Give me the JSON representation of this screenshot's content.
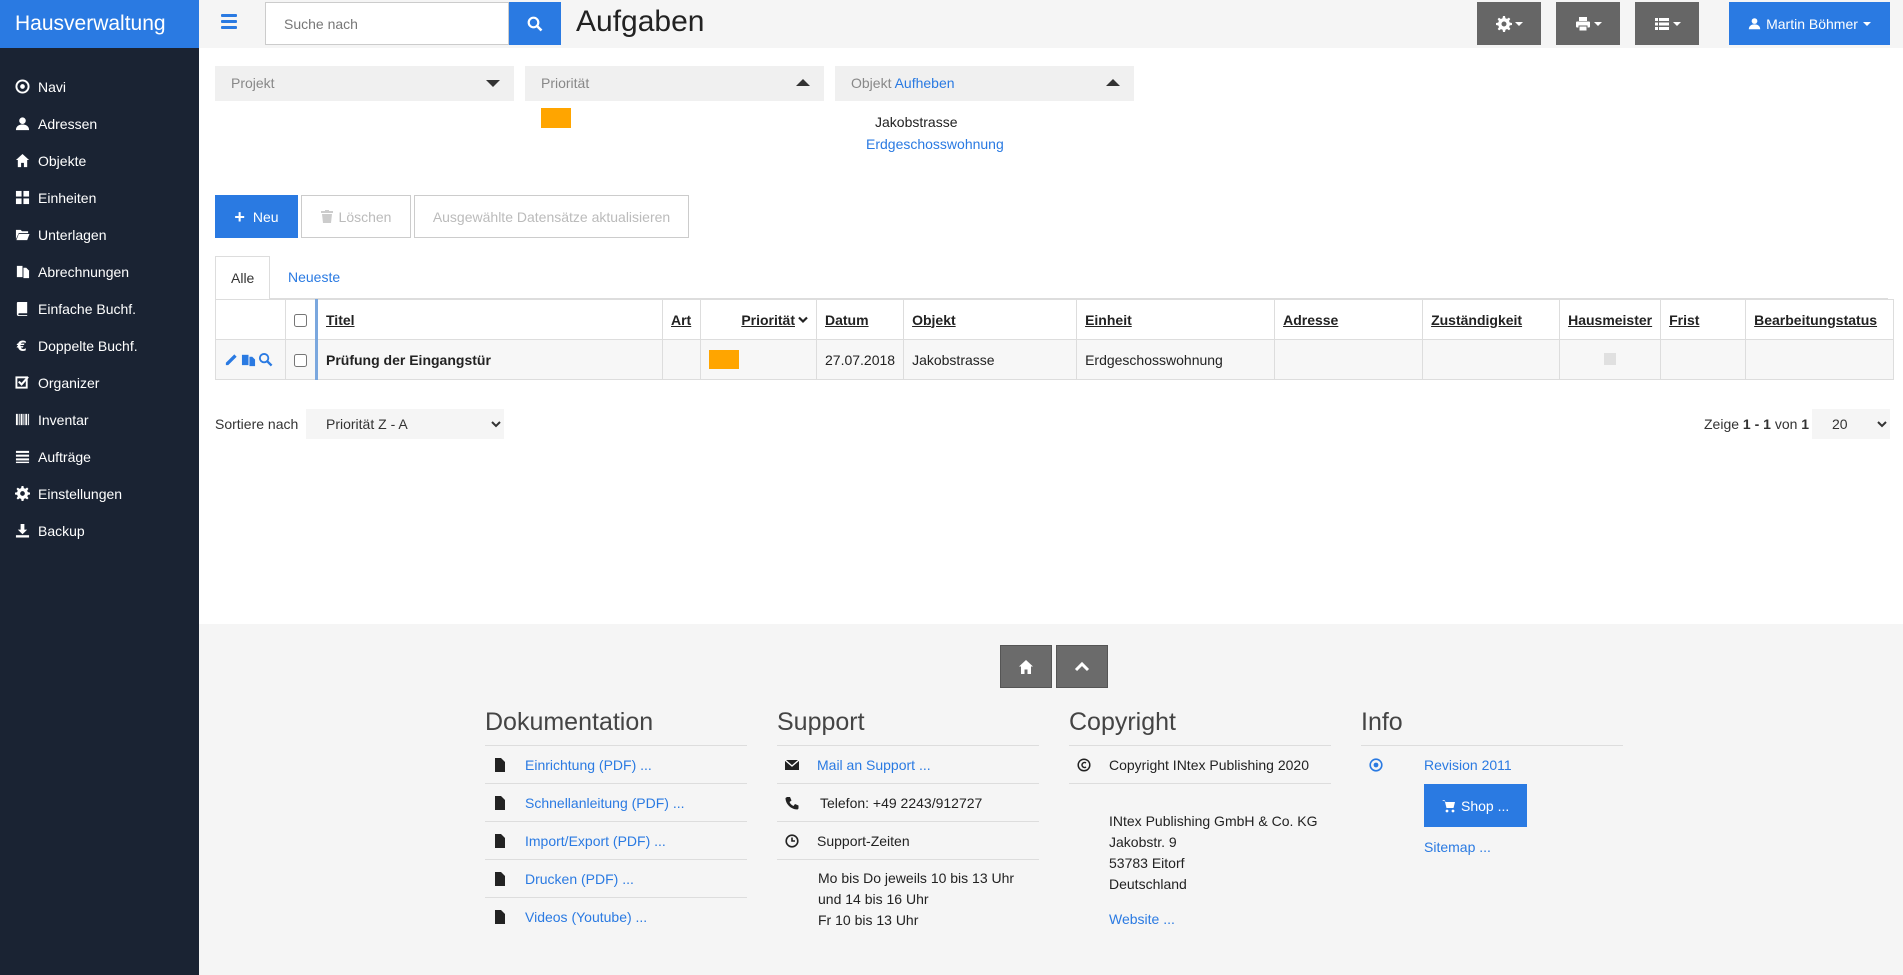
{
  "brand": "Hausverwaltung",
  "nav": [
    {
      "label": "Navi",
      "icon": "target-icon"
    },
    {
      "label": "Adressen",
      "icon": "user-icon"
    },
    {
      "label": "Objekte",
      "icon": "home-icon"
    },
    {
      "label": "Einheiten",
      "icon": "grid-icon"
    },
    {
      "label": "Unterlagen",
      "icon": "folder-icon"
    },
    {
      "label": "Abrechnungen",
      "icon": "documents-icon"
    },
    {
      "label": "Einfache Buchf.",
      "icon": "book-icon"
    },
    {
      "label": "Doppelte Buchf.",
      "icon": "euro-icon"
    },
    {
      "label": "Organizer",
      "icon": "checkbox-icon"
    },
    {
      "label": "Inventar",
      "icon": "barcode-icon"
    },
    {
      "label": "Aufträge",
      "icon": "list-icon"
    },
    {
      "label": "Einstellungen",
      "icon": "gear-icon"
    },
    {
      "label": "Backup",
      "icon": "download-icon"
    }
  ],
  "topbar": {
    "search_placeholder": "Suche nach",
    "title": "Aufgaben",
    "user": "Martin Böhmer"
  },
  "filters": {
    "projekt": "Projekt",
    "prioritaet": "Priorität",
    "objekt": "Objekt",
    "objekt_clear": "Aufheben",
    "objekt_name": "Jakobstrasse",
    "objekt_unit": "Erdgeschosswohnung",
    "prio_color": "#ffa500"
  },
  "actions": {
    "new": "Neu",
    "delete": "Löschen",
    "update": "Ausgewählte Datensätze aktualisieren"
  },
  "tabs": {
    "all": "Alle",
    "newest": "Neueste"
  },
  "table": {
    "headers": [
      "Titel",
      "Art",
      "Priorität",
      "Datum",
      "Objekt",
      "Einheit",
      "Adresse",
      "Zuständigkeit",
      "Hausmeister",
      "Frist",
      "Bearbeitungstatus"
    ],
    "rows": [
      {
        "titel": "Prüfung der Eingangstür",
        "art": "",
        "datum": "27.07.2018",
        "objekt": "Jakobstrasse",
        "einheit": "Erdgeschosswohnung",
        "adresse": "",
        "zustaendigkeit": "",
        "frist": "",
        "status": ""
      }
    ]
  },
  "sorting": {
    "label": "Sortiere nach",
    "value": "Priorität Z - A",
    "paging_prefix": "Zeige",
    "paging_range": "1 - 1",
    "paging_of": "von",
    "paging_total": "1",
    "page_size": "20"
  },
  "footer": {
    "doc_title": "Dokumentation",
    "doc_links": [
      "Einrichtung (PDF) ...",
      "Schnellanleitung (PDF) ...",
      "Import/Export (PDF) ...",
      "Drucken (PDF) ...",
      "Videos (Youtube) ..."
    ],
    "support_title": "Support",
    "support_mail": "Mail an Support ...",
    "support_phone": "Telefon: +49 2243/912727",
    "support_hours_title": "Support-Zeiten",
    "support_hours_1": "Mo bis Do jeweils 10 bis 13 Uhr",
    "support_hours_2": "und 14 bis 16 Uhr",
    "support_hours_3": "Fr 10 bis 13 Uhr",
    "copyright_title": "Copyright",
    "copyright_text": "Copyright INtex Publishing 2020",
    "company": "INtex Publishing GmbH & Co. KG",
    "street": "Jakobstr. 9",
    "city": "53783 Eitorf",
    "country": "Deutschland",
    "website": "Website ...",
    "info_title": "Info",
    "revision": "Revision 2011",
    "shop": "Shop ...",
    "sitemap": "Sitemap ..."
  },
  "colors": {
    "accent": "#2a7ae2",
    "sidebar": "#1a2333",
    "priority_orange": "#ffa500"
  }
}
